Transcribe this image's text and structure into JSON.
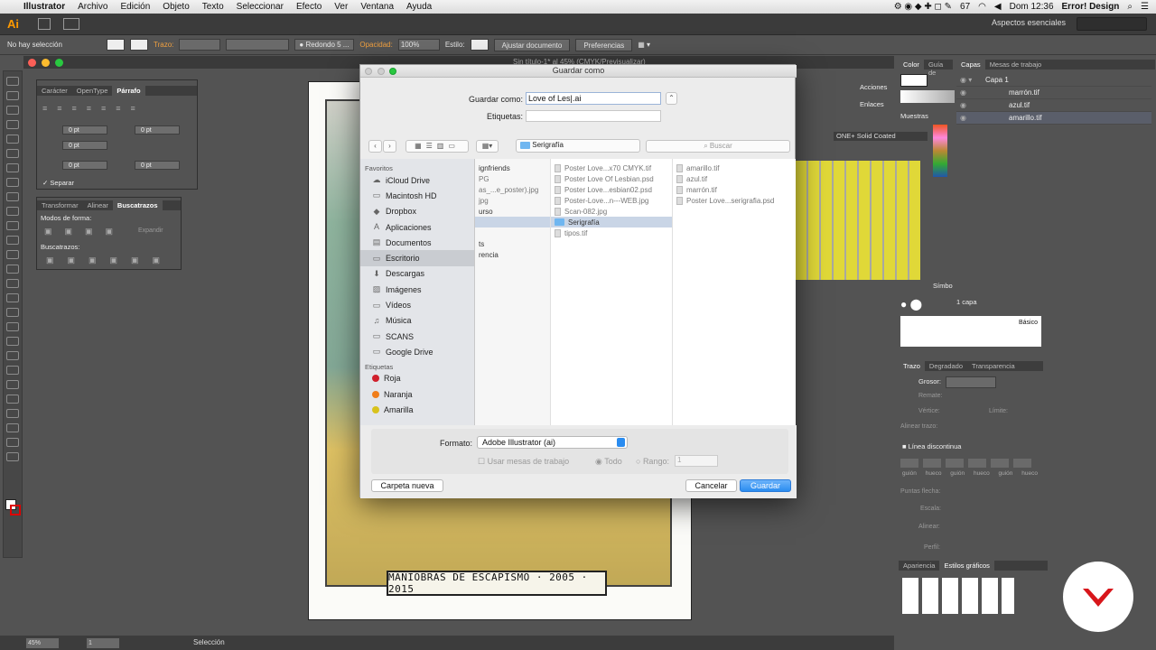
{
  "menubar": {
    "app": "Illustrator",
    "items": [
      "Archivo",
      "Edición",
      "Objeto",
      "Texto",
      "Seleccionar",
      "Efecto",
      "Ver",
      "Ventana",
      "Ayuda"
    ],
    "clock": "Dom 12:36",
    "user": "Error! Design",
    "battery": "67"
  },
  "appbar": {
    "logo": "Ai",
    "workspace": "Aspectos esenciales"
  },
  "ctrlbar": {
    "selection": "No hay selección",
    "stroke_label": "Trazo:",
    "brush": "Redondo 5 ...",
    "opacity_label": "Opacidad:",
    "opacity_value": "100%",
    "style_label": "Estilo:",
    "doc_setup": "Ajustar documento",
    "prefs": "Preferencias"
  },
  "document": {
    "title": "Sin título-1* al 45% (CMYK/Previsualizar)",
    "banner_text": "MANIOBRAS DE ESCAPISMO · 2005 · 2015"
  },
  "char_panel": {
    "tabs": [
      "Carácter",
      "OpenType",
      "Párrafo"
    ],
    "fields": [
      "0 pt",
      "0 pt",
      "0 pt",
      "0 pt",
      "0 pt"
    ],
    "checkbox_label": "Separar"
  },
  "pathfinder_panel": {
    "tabs": [
      "Transformar",
      "Alinear",
      "Buscatrazos"
    ],
    "shape_modes": "Modos de forma:",
    "expand": "Expandir",
    "pathfinders": "Buscatrazos:"
  },
  "dialog": {
    "title": "Guardar como",
    "save_as_label": "Guardar como:",
    "save_as_value": "Love of Les|.ai",
    "tags_label": "Etiquetas:",
    "location": "Serigrafía",
    "search_placeholder": "Buscar",
    "favorites_head": "Favoritos",
    "favorites": [
      {
        "icon": "cloud-icon",
        "label": "iCloud Drive",
        "glyph": "☁"
      },
      {
        "icon": "disk-icon",
        "label": "Macintosh HD",
        "glyph": "▭"
      },
      {
        "icon": "dropbox-icon",
        "label": "Dropbox",
        "glyph": "◆"
      },
      {
        "icon": "applications-icon",
        "label": "Aplicaciones",
        "glyph": "A"
      },
      {
        "icon": "documents-icon",
        "label": "Documentos",
        "glyph": "▤"
      },
      {
        "icon": "desktop-icon",
        "label": "Escritorio",
        "glyph": "▭"
      },
      {
        "icon": "downloads-icon",
        "label": "Descargas",
        "glyph": "⬇"
      },
      {
        "icon": "images-icon",
        "label": "Imágenes",
        "glyph": "▨"
      },
      {
        "icon": "videos-icon",
        "label": "Vídeos",
        "glyph": "▭"
      },
      {
        "icon": "music-icon",
        "label": "Música",
        "glyph": "♫"
      },
      {
        "icon": "folder-icon",
        "label": "SCANS",
        "glyph": "▭"
      },
      {
        "icon": "folder-icon",
        "label": "Google Drive",
        "glyph": "▭"
      }
    ],
    "tags_head": "Etiquetas",
    "tags": [
      {
        "label": "Roja",
        "color": "#d0202c"
      },
      {
        "label": "Naranja",
        "color": "#f07d1a"
      },
      {
        "label": "Amarilla",
        "color": "#d8c21c"
      }
    ],
    "col1": [
      "ignfriends",
      "PG",
      "as_...e_poster).jpg",
      "jpg",
      "urso",
      "",
      "ts",
      "rencia"
    ],
    "col2": [
      {
        "label": "Poster Love...x70 CMYK.tif",
        "type": "file",
        "dim": true
      },
      {
        "label": "Poster Love Of Lesbian.psd",
        "type": "file",
        "dim": true
      },
      {
        "label": "Poster Love...esbian02.psd",
        "type": "file",
        "dim": true
      },
      {
        "label": "Poster-Love...n---WEB.jpg",
        "type": "file",
        "dim": true
      },
      {
        "label": "Scan-082.jpg",
        "type": "file",
        "dim": true
      },
      {
        "label": "Serigrafía",
        "type": "folder",
        "dim": false
      },
      {
        "label": "tipos.tif",
        "type": "file",
        "dim": true
      }
    ],
    "col3": [
      "amarillo.tif",
      "azul.tif",
      "marrón.tif",
      "Poster Love...serigrafia.psd"
    ],
    "format_label": "Formato:",
    "format_value": "Adobe Illustrator (ai)",
    "artboards_label": "Usar mesas de trabajo",
    "all_label": "Todo",
    "range_label": "Rango:",
    "range_value": "1",
    "new_folder": "Carpeta nueva",
    "cancel": "Cancelar",
    "save": "Guardar"
  },
  "right_panel": {
    "color_tabs": [
      "Color",
      "Guía de"
    ],
    "layer_tabs": [
      "Capas",
      "Mesas de trabajo"
    ],
    "actions": "Acciones",
    "links": "Enlaces",
    "swatches": "Muestras",
    "swatch_lib": "ONE+ Solid Coated",
    "layers": [
      "Capa 1",
      "marrón.tif",
      "azul.tif",
      "amarillo.tif"
    ],
    "layer_count": "1 capa",
    "symbols": "Símbo",
    "brush_basic": "Básico",
    "stroke_tabs": [
      "Trazo",
      "Degradado",
      "Transparencia"
    ],
    "stroke_labels": [
      "Grosor:",
      "Remate:",
      "Vértice:",
      "Límite:",
      "Alinear trazo:"
    ],
    "dashed": "Línea discontinua",
    "dash_labels": [
      "guión",
      "hueco",
      "guión",
      "hueco",
      "guión",
      "hueco"
    ],
    "arrow_labels": [
      "Puntas flecha:",
      "Escala:",
      "Alinear:",
      "Perfil:"
    ],
    "appearance_tabs": [
      "Apariencia",
      "Estilos gráficos"
    ]
  },
  "statusbar": {
    "zoom": "45%",
    "page": "1",
    "tool": "Selección"
  }
}
